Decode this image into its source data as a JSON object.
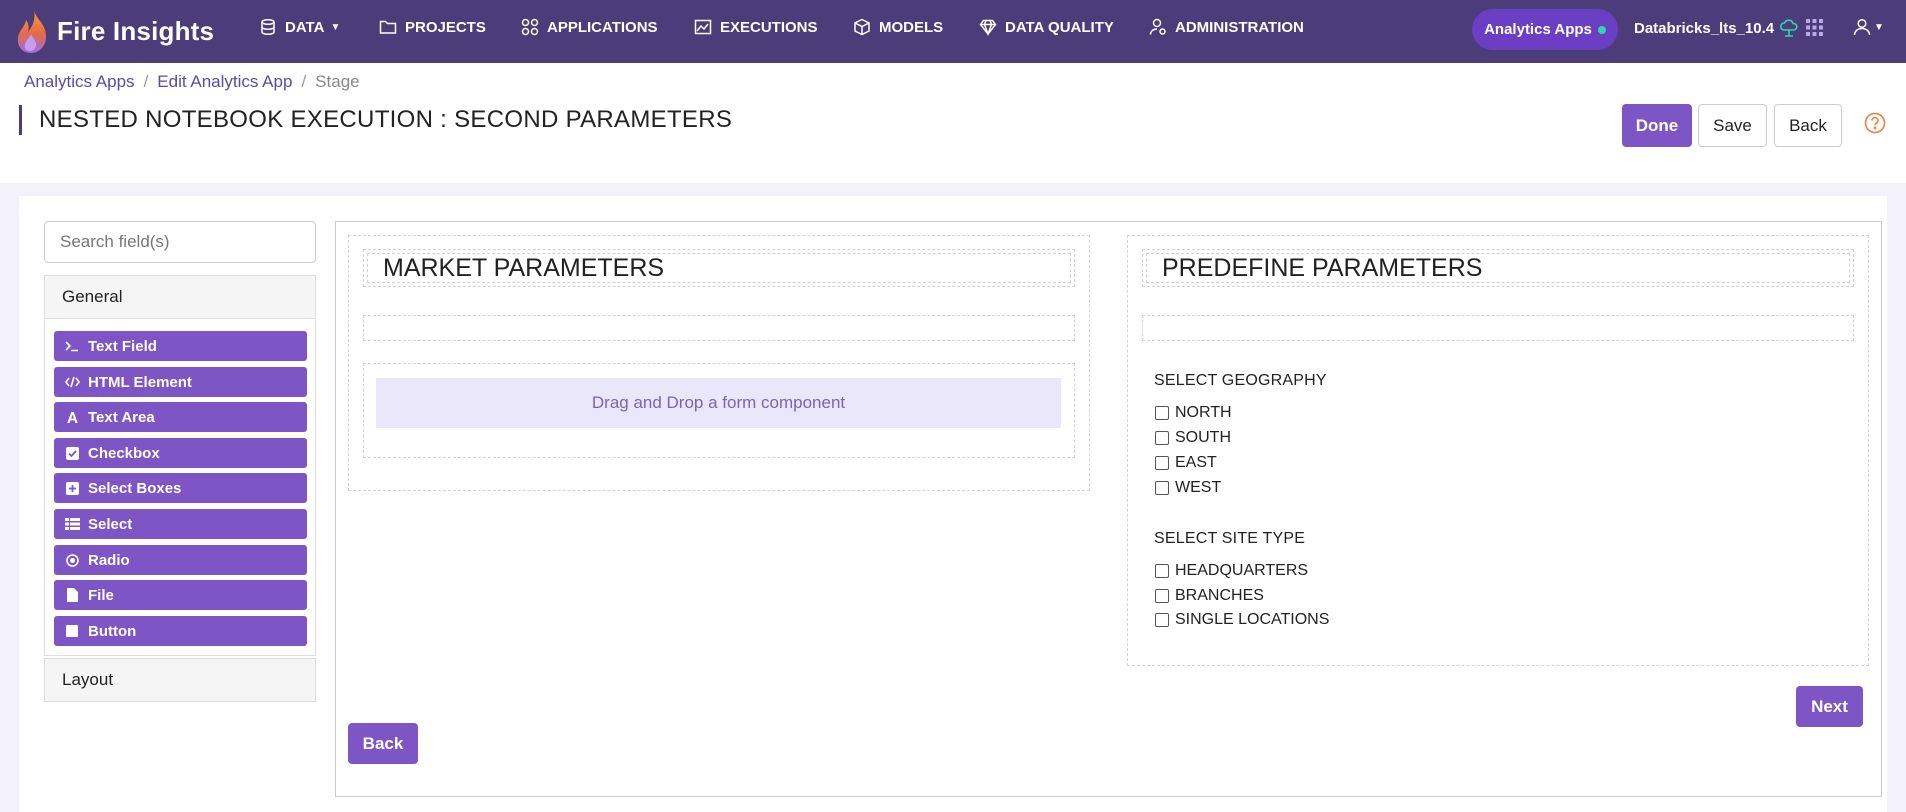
{
  "brand": {
    "name": "Fire Insights"
  },
  "nav": {
    "items": [
      {
        "label": "DATA",
        "icon": "database-icon"
      },
      {
        "label": "PROJECTS",
        "icon": "folder-icon"
      },
      {
        "label": "APPLICATIONS",
        "icon": "apps-icon"
      },
      {
        "label": "EXECUTIONS",
        "icon": "chart-icon"
      },
      {
        "label": "MODELS",
        "icon": "cube-icon"
      },
      {
        "label": "DATA QUALITY",
        "icon": "diamond-icon"
      },
      {
        "label": "ADMINISTRATION",
        "icon": "user-cog-icon"
      }
    ],
    "pill_label": "Analytics Apps",
    "cluster_label": "Databricks_lts_10.4"
  },
  "breadcrumb": {
    "items": [
      "Analytics Apps",
      "Edit Analytics App"
    ],
    "separator": "/",
    "current": "Stage"
  },
  "page": {
    "title": "NESTED NOTEBOOK EXECUTION : SECOND PARAMETERS",
    "done_label": "Done",
    "save_label": "Save",
    "back_label": "Back"
  },
  "sidebar": {
    "search_placeholder": "Search field(s)",
    "general_label": "General",
    "layout_label": "Layout",
    "components": [
      {
        "label": "Text Field",
        "icon": "terminal-icon"
      },
      {
        "label": "HTML Element",
        "icon": "code-icon"
      },
      {
        "label": "Text Area",
        "icon": "font-icon"
      },
      {
        "label": "Checkbox",
        "icon": "check-square-icon"
      },
      {
        "label": "Select Boxes",
        "icon": "plus-square-icon"
      },
      {
        "label": "Select",
        "icon": "table-list-icon"
      },
      {
        "label": "Radio",
        "icon": "dot-circle-icon"
      },
      {
        "label": "File",
        "icon": "file-icon"
      },
      {
        "label": "Button",
        "icon": "stop-icon"
      }
    ]
  },
  "builder": {
    "left_title": "MARKET PARAMETERS",
    "right_title": "PREDEFINE PARAMETERS",
    "dropzone_text": "Drag and Drop a form component",
    "geography": {
      "label": "SELECT GEOGRAPHY",
      "options": [
        "NORTH",
        "SOUTH",
        "EAST",
        "WEST"
      ]
    },
    "site_type": {
      "label": "SELECT SITE TYPE",
      "options": [
        "HEADQUARTERS",
        "BRANCHES",
        "SINGLE LOCATIONS"
      ]
    },
    "next_label": "Next",
    "back_label": "Back"
  },
  "colors": {
    "navbar": "#4d3c7a",
    "accent": "#7e55c5",
    "pill": "#6a3fc4",
    "status_dot": "#2fd6b0",
    "help": "#e8884a"
  }
}
